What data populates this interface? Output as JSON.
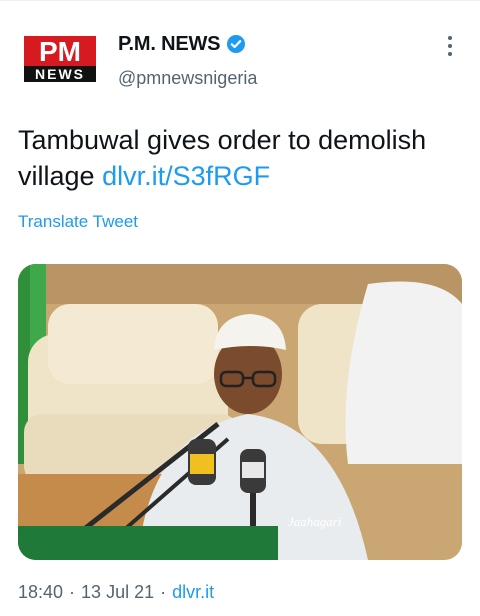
{
  "author": {
    "logo_top": "PM",
    "logo_bottom": "NEWS",
    "display_name": "P.M. NEWS",
    "handle": "@pmnewsnigeria",
    "verified_icon": "verified-badge-icon",
    "brand_color": "#d71920"
  },
  "tweet": {
    "text": "Tambuwal gives order to demolish village",
    "link": "dlvr.it/S3fRGF",
    "translate_label": "Translate Tweet"
  },
  "media": {
    "watermark": "Jaahagari"
  },
  "meta": {
    "time": "18:40",
    "date": "13 Jul 21",
    "source": "dlvr.it"
  },
  "colors": {
    "accent": "#1d9bf0",
    "text": "#0f1419",
    "secondary": "#536471"
  }
}
